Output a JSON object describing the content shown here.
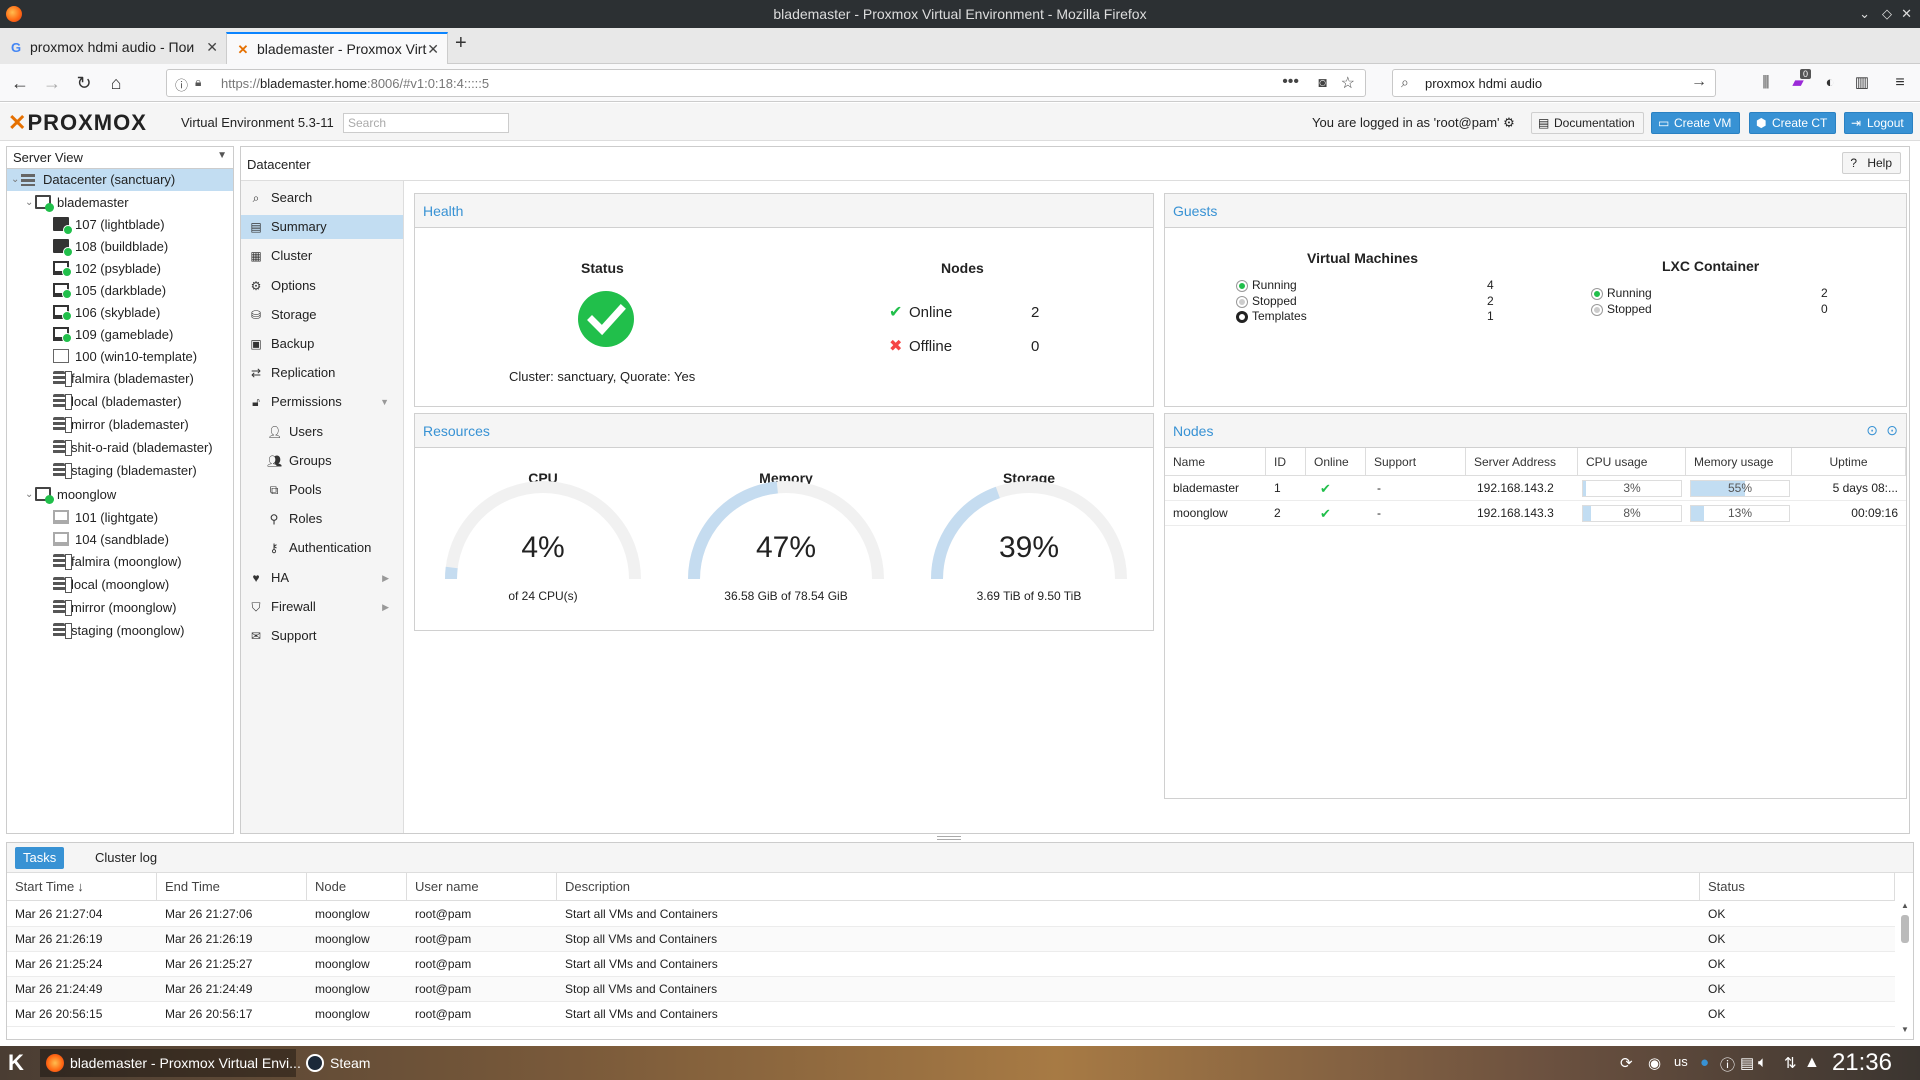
{
  "window": {
    "title": "blademaster - Proxmox Virtual Environment - Mozilla Firefox"
  },
  "browser": {
    "tabs": [
      {
        "label": "proxmox hdmi audio - Пои",
        "active": false,
        "icon": "google-icon"
      },
      {
        "label": "blademaster - Proxmox Virt",
        "active": true,
        "icon": "proxmox-icon"
      }
    ],
    "url_prefix": "https://",
    "url_host": "blademaster.home",
    "url_rest": ":8006/#v1:0:18:4:::::5",
    "search_value": "proxmox hdmi audio",
    "addon_badge": "0"
  },
  "pve": {
    "logo": "PROXMOX",
    "version": "Virtual Environment 5.3-11",
    "search_placeholder": "Search",
    "logged_in": "You are logged in as 'root@pam'",
    "buttons": {
      "docs": "Documentation",
      "create_vm": "Create VM",
      "create_ct": "Create CT",
      "logout": "Logout"
    }
  },
  "tree": {
    "view": "Server View",
    "items": [
      {
        "label": "Datacenter (sanctuary)",
        "type": "datacenter"
      },
      {
        "label": "blademaster",
        "type": "node"
      },
      {
        "label": "107 (lightblade)",
        "type": "ct"
      },
      {
        "label": "108 (buildblade)",
        "type": "ct"
      },
      {
        "label": "102 (psyblade)",
        "type": "vm"
      },
      {
        "label": "105 (darkblade)",
        "type": "vm"
      },
      {
        "label": "106 (skyblade)",
        "type": "vm"
      },
      {
        "label": "109 (gameblade)",
        "type": "vm"
      },
      {
        "label": "100 (win10-template)",
        "type": "template"
      },
      {
        "label": "falmira (blademaster)",
        "type": "storage"
      },
      {
        "label": "local (blademaster)",
        "type": "storage"
      },
      {
        "label": "mirror (blademaster)",
        "type": "storage"
      },
      {
        "label": "shit-o-raid (blademaster)",
        "type": "storage"
      },
      {
        "label": "staging (blademaster)",
        "type": "storage"
      },
      {
        "label": "moonglow",
        "type": "node"
      },
      {
        "label": "101 (lightgate)",
        "type": "vm-off"
      },
      {
        "label": "104 (sandblade)",
        "type": "vm-off"
      },
      {
        "label": "falmira (moonglow)",
        "type": "storage"
      },
      {
        "label": "local (moonglow)",
        "type": "storage"
      },
      {
        "label": "mirror (moonglow)",
        "type": "storage"
      },
      {
        "label": "staging (moonglow)",
        "type": "storage"
      }
    ]
  },
  "breadcrumb": "Datacenter",
  "help_label": "Help",
  "menu": [
    {
      "label": "Search",
      "icon": "search-icon"
    },
    {
      "label": "Summary",
      "icon": "book-icon",
      "selected": true
    },
    {
      "label": "Cluster",
      "icon": "server-icon"
    },
    {
      "label": "Options",
      "icon": "gear-icon"
    },
    {
      "label": "Storage",
      "icon": "database-icon"
    },
    {
      "label": "Backup",
      "icon": "floppy-icon"
    },
    {
      "label": "Replication",
      "icon": "retweet-icon"
    },
    {
      "label": "Permissions",
      "icon": "unlock-icon",
      "expanded": true
    },
    {
      "label": "Users",
      "icon": "user-icon",
      "sub": true
    },
    {
      "label": "Groups",
      "icon": "users-icon",
      "sub": true
    },
    {
      "label": "Pools",
      "icon": "tags-icon",
      "sub": true
    },
    {
      "label": "Roles",
      "icon": "male-icon",
      "sub": true
    },
    {
      "label": "Authentication",
      "icon": "key-icon",
      "sub": true
    },
    {
      "label": "HA",
      "icon": "heartbeat-icon",
      "arrow": true
    },
    {
      "label": "Firewall",
      "icon": "shield-icon",
      "arrow": true
    },
    {
      "label": "Support",
      "icon": "comments-icon"
    }
  ],
  "health": {
    "title": "Health",
    "status_heading": "Status",
    "cluster_text": "Cluster: sanctuary, Quorate: Yes",
    "nodes_heading": "Nodes",
    "online_label": "Online",
    "online_count": "2",
    "offline_label": "Offline",
    "offline_count": "0"
  },
  "guests": {
    "title": "Guests",
    "vm_heading": "Virtual Machines",
    "vm": [
      {
        "label": "Running",
        "value": "4"
      },
      {
        "label": "Stopped",
        "value": "2"
      },
      {
        "label": "Templates",
        "value": "1"
      }
    ],
    "lxc_heading": "LXC Container",
    "lxc": [
      {
        "label": "Running",
        "value": "2"
      },
      {
        "label": "Stopped",
        "value": "0"
      }
    ]
  },
  "resources": {
    "title": "Resources",
    "gauges": [
      {
        "label": "CPU",
        "value": "4%",
        "fraction": 0.04,
        "sub": "of 24 CPU(s)"
      },
      {
        "label": "Memory",
        "value": "47%",
        "fraction": 0.47,
        "sub": "36.58 GiB of 78.54 GiB"
      },
      {
        "label": "Storage",
        "value": "39%",
        "fraction": 0.39,
        "sub": "3.69 TiB of 9.50 TiB"
      }
    ]
  },
  "nodes": {
    "title": "Nodes",
    "columns": [
      "Name",
      "ID",
      "Online",
      "Support",
      "Server Address",
      "CPU usage",
      "Memory usage",
      "Uptime"
    ],
    "rows": [
      {
        "name": "blademaster",
        "id": "1",
        "support": "-",
        "address": "192.168.143.2",
        "cpu": "3%",
        "cpu_frac": 0.03,
        "mem": "55%",
        "mem_frac": 0.55,
        "uptime": "5 days 08:..."
      },
      {
        "name": "moonglow",
        "id": "2",
        "support": "-",
        "address": "192.168.143.3",
        "cpu": "8%",
        "cpu_frac": 0.08,
        "mem": "13%",
        "mem_frac": 0.13,
        "uptime": "00:09:16"
      }
    ]
  },
  "tasks": {
    "tabs": [
      "Tasks",
      "Cluster log"
    ],
    "columns": [
      "Start Time",
      "End Time",
      "Node",
      "User name",
      "Description",
      "Status"
    ],
    "sort_indicator": "↓",
    "rows": [
      {
        "start": "Mar 26 21:27:04",
        "end": "Mar 26 21:27:06",
        "node": "moonglow",
        "user": "root@pam",
        "desc": "Start all VMs and Containers",
        "status": "OK"
      },
      {
        "start": "Mar 26 21:26:19",
        "end": "Mar 26 21:26:19",
        "node": "moonglow",
        "user": "root@pam",
        "desc": "Stop all VMs and Containers",
        "status": "OK"
      },
      {
        "start": "Mar 26 21:25:24",
        "end": "Mar 26 21:25:27",
        "node": "moonglow",
        "user": "root@pam",
        "desc": "Start all VMs and Containers",
        "status": "OK"
      },
      {
        "start": "Mar 26 21:24:49",
        "end": "Mar 26 21:24:49",
        "node": "moonglow",
        "user": "root@pam",
        "desc": "Stop all VMs and Containers",
        "status": "OK"
      },
      {
        "start": "Mar 26 20:56:15",
        "end": "Mar 26 20:56:17",
        "node": "moonglow",
        "user": "root@pam",
        "desc": "Start all VMs and Containers",
        "status": "OK"
      }
    ]
  },
  "taskbar": {
    "items": [
      {
        "label": "blademaster - Proxmox Virtual Envi..."
      },
      {
        "label": "Steam"
      }
    ],
    "keyboard": "us",
    "clock": "21:36"
  },
  "colors": {
    "accent": "#3892d4",
    "ok": "#21bf4b",
    "error": "#f54545",
    "gauge_track": "#f1f1f1",
    "gauge_fill": "#c5dcf0",
    "brand": "#e57000"
  }
}
